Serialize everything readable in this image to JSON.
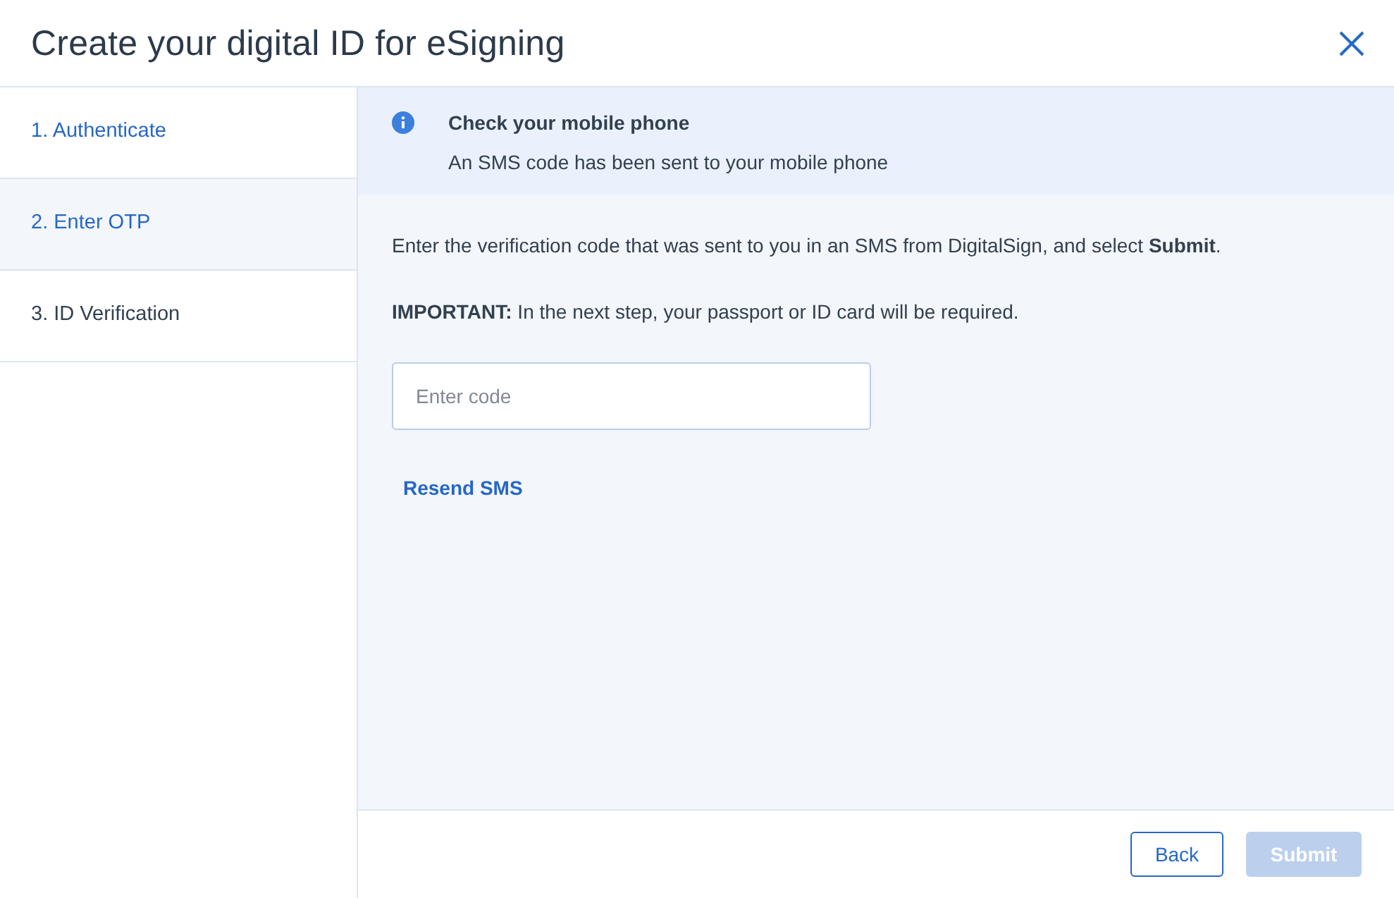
{
  "dialog": {
    "title": "Create your digital ID for eSigning"
  },
  "steps": [
    {
      "label": "1. Authenticate",
      "selected": false,
      "available": true
    },
    {
      "label": "2. Enter OTP",
      "selected": true,
      "available": true
    },
    {
      "label": "3. ID Verification",
      "selected": false,
      "available": false
    }
  ],
  "alert": {
    "kind": "info",
    "title": "Check your mobile phone",
    "message": "An SMS code has been sent to your mobile phone"
  },
  "instructions": [
    "Enter the verification code that was sent to you in an SMS from DigitalSign, and select **Submit**.",
    "**IMPORTANT:** In the next step, your passport or ID card will be required."
  ],
  "code_field": {
    "placeholder": "Enter code"
  },
  "resend_link": "Resend SMS",
  "buttons": [
    {
      "label": "Back",
      "kind": "secondary",
      "disabled": false
    },
    {
      "label": "Submit",
      "kind": "primary",
      "disabled": true
    }
  ]
}
